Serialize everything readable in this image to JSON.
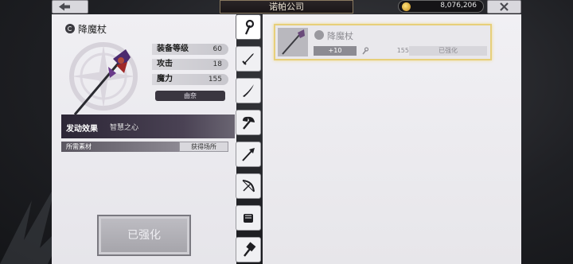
{
  "header": {
    "title": "诺帕公司",
    "gold": "8,076,206",
    "back_icon": "back-arrow-icon",
    "close_icon": "close-x-icon"
  },
  "weapon": {
    "name": "降魔杖",
    "stats": [
      {
        "label": "装备等级",
        "value": "60"
      },
      {
        "label": "攻击",
        "value": "18"
      },
      {
        "label": "魔力",
        "value": "155"
      }
    ],
    "origin": "由奈",
    "effect_label": "发动效果",
    "effect_value": "智慧之心",
    "materials_label": "所需素材",
    "acquire_label": "获得场所",
    "enhanced_label": "已强化"
  },
  "tabs": [
    {
      "icon": "staff-icon",
      "active": true
    },
    {
      "icon": "sword-icon"
    },
    {
      "icon": "katana-icon"
    },
    {
      "icon": "axe-icon"
    },
    {
      "icon": "spear-icon"
    },
    {
      "icon": "bow-icon"
    },
    {
      "icon": "fist-icon"
    },
    {
      "icon": "hammer-icon"
    }
  ],
  "list": [
    {
      "name": "降魔杖",
      "level": "+10",
      "stat": "155",
      "status": "已强化"
    }
  ],
  "colors": {
    "card_highlight": "#e7cf7a",
    "effect_band": "#2c2636"
  }
}
